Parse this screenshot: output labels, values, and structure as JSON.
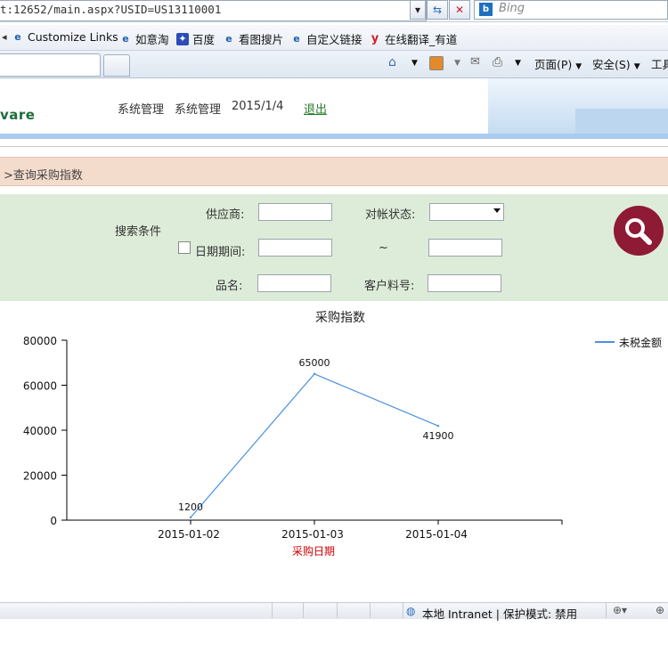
{
  "browser": {
    "url": "t:12652/main.aspx?USID=US13110001",
    "search_engine": "Bing",
    "favorites": [
      {
        "label": "Customize Links",
        "icon": "ie-page-icon"
      },
      {
        "label": "如意淘",
        "icon": "ie-page-icon"
      },
      {
        "label": "百度",
        "icon": "baidu-paw-icon"
      },
      {
        "label": "看图搜片",
        "icon": "ie-page-icon"
      },
      {
        "label": "自定义链接",
        "icon": "ie-page-icon"
      },
      {
        "label": "在线翻译_有道",
        "icon": "youdao-icon"
      }
    ],
    "commands": {
      "page": "页面(P)",
      "safety": "安全(S)",
      "tools": "工具"
    },
    "status": "本地 Intranet | 保护模式: 禁用"
  },
  "header": {
    "brand": "vare",
    "nav1": "系统管理",
    "nav2": "系统管理",
    "date": "2015/1/4",
    "logout": "退出"
  },
  "breadcrumb": ">查询采购指数",
  "search": {
    "title": "搜索条件",
    "supplier_label": "供应商:",
    "supplier_value": "",
    "status_label": "对帐状态:",
    "status_value": "",
    "date_label": "日期期间:",
    "date_from": "",
    "date_sep": "~",
    "date_to": "",
    "product_label": "品名:",
    "product_value": "",
    "customer_no_label": "客户料号:",
    "customer_no_value": ""
  },
  "chart_data": {
    "type": "line",
    "title": "采购指数",
    "xlabel": "采购日期",
    "ylabel": "",
    "categories": [
      "2015-01-02",
      "2015-01-03",
      "2015-01-04"
    ],
    "series": [
      {
        "name": "未税金额",
        "values": [
          1200,
          65000,
          41900
        ],
        "color": "#4a90e2"
      }
    ],
    "ylim": [
      0,
      80000
    ],
    "yticks": [
      0,
      20000,
      40000,
      60000,
      80000
    ],
    "legend": "top-right",
    "grid": false
  },
  "colors": {
    "search_button": "#8e1a35",
    "xlabel": "#cc0000",
    "panel_bg": "#ddecd9",
    "crumb_bg": "#f4dccd"
  }
}
